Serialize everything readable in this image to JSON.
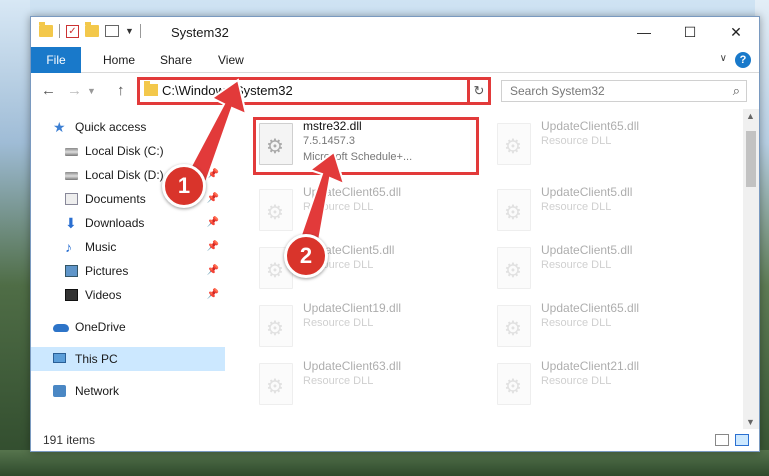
{
  "window": {
    "title": "System32",
    "controls": {
      "minimize": "—",
      "maximize": "☐",
      "close": "✕"
    }
  },
  "ribbon": {
    "tabs": [
      "File",
      "Home",
      "Share",
      "View"
    ],
    "help": "?"
  },
  "address": {
    "path": "C:\\Windows\\System32",
    "search_placeholder": "Search System32"
  },
  "nav_pane": [
    {
      "label": "Quick access",
      "icon": "star-icon",
      "level": 0,
      "pinned": false
    },
    {
      "label": "Local Disk (C:)",
      "icon": "disk-icon",
      "level": 1,
      "pinned": true
    },
    {
      "label": "Local Disk (D:)",
      "icon": "disk-icon",
      "level": 1,
      "pinned": true
    },
    {
      "label": "Documents",
      "icon": "documents-icon",
      "level": 1,
      "pinned": true
    },
    {
      "label": "Downloads",
      "icon": "download-icon",
      "level": 1,
      "pinned": true
    },
    {
      "label": "Music",
      "icon": "music-icon",
      "level": 1,
      "pinned": true
    },
    {
      "label": "Pictures",
      "icon": "pictures-icon",
      "level": 1,
      "pinned": true
    },
    {
      "label": "Videos",
      "icon": "videos-icon",
      "level": 1,
      "pinned": true
    },
    {
      "label": "OneDrive",
      "icon": "onedrive-icon",
      "level": 0,
      "pinned": false
    },
    {
      "label": "This PC",
      "icon": "pc-icon",
      "level": 0,
      "pinned": false,
      "selected": true
    },
    {
      "label": "Network",
      "icon": "network-icon",
      "level": 0,
      "pinned": false
    }
  ],
  "files": {
    "highlighted": {
      "name": "mstre32.dll",
      "version": "7.5.1457.3",
      "description": "Microsoft Schedule+..."
    },
    "background": [
      {
        "name": "UpdateClient65.dll",
        "description": "Resource DLL"
      },
      {
        "name": "UpdateClient65.dll",
        "description": "Resource DLL"
      },
      {
        "name": "UpdateClient5.dll",
        "description": "Resource DLL"
      },
      {
        "name": "UpdateClient5.dll",
        "description": "Resource DLL"
      },
      {
        "name": "UpdateClient5.dll",
        "description": "Resource DLL"
      },
      {
        "name": "UpdateClient19.dll",
        "description": "Resource DLL"
      },
      {
        "name": "UpdateClient65.dll",
        "description": "Resource DLL"
      },
      {
        "name": "UpdateClient63.dll",
        "description": "Resource DLL"
      },
      {
        "name": "UpdateClient21.dll",
        "description": "Resource DLL"
      }
    ]
  },
  "status": {
    "item_count": "191 items"
  },
  "annotations": {
    "step1": "1",
    "step2": "2",
    "accent_color": "#e23a3a"
  }
}
